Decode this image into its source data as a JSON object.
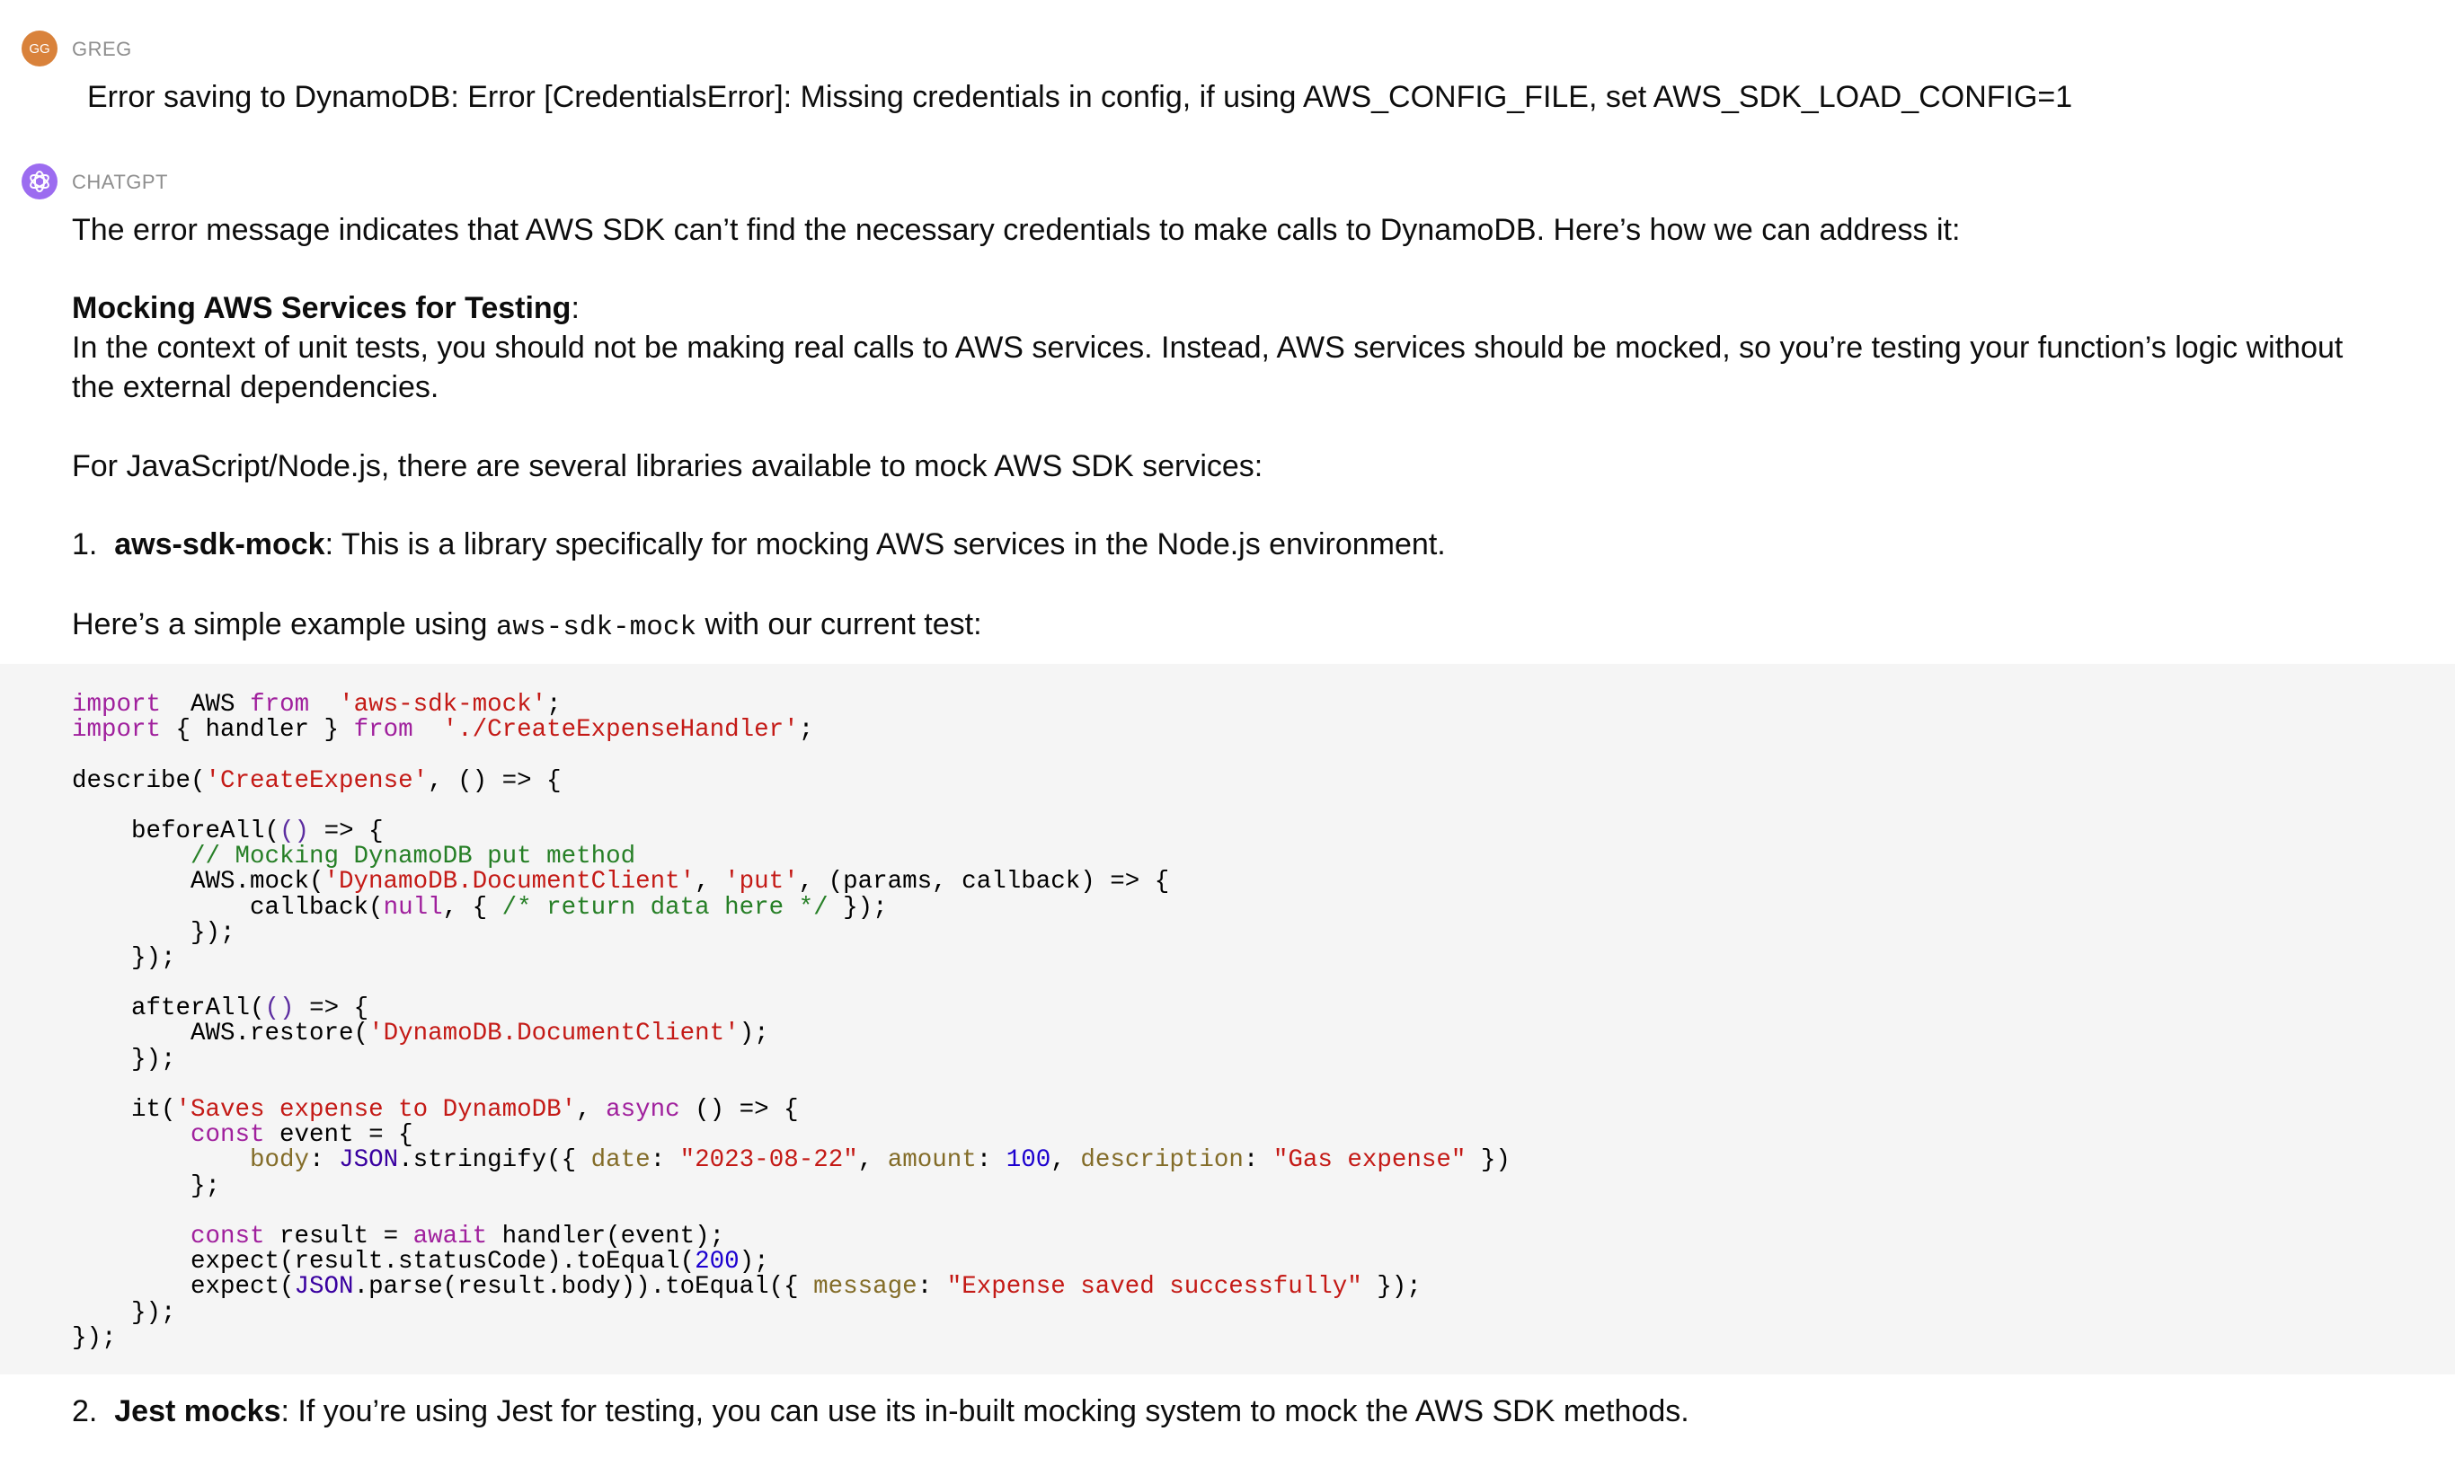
{
  "user": {
    "initials": "GG",
    "name": "GREG",
    "avatar_color": "#d9823b",
    "message": "Error saving to DynamoDB: Error [CredentialsError]: Missing credentials in config, if using AWS_CONFIG_FILE, set AWS_SDK_LOAD_CONFIG=1"
  },
  "assistant": {
    "name": "CHATGPT",
    "avatar_color": "#9c6cf0",
    "icon": "openai-logo-icon",
    "intro": "The error message indicates that AWS SDK can’t find the necessary credentials to make calls to DynamoDB. Here’s how we can address it:",
    "heading": "Mocking AWS Services for Testing",
    "heading_suffix": ":",
    "para1": "In the context of unit tests, you should not be making real calls to AWS services. Instead, AWS services should be mocked, so you’re testing your function’s logic without the external dependencies.",
    "para2": "For JavaScript/Node.js, there are several libraries available to mock AWS SDK services:",
    "item1": {
      "num": "1.",
      "title": "aws-sdk-mock",
      "text": ": This is a library specifically for mocking AWS services in the Node.js environment."
    },
    "example_pre": "Here’s a simple example using ",
    "example_code": "aws-sdk-mock",
    "example_post": " with our current test:",
    "item2": {
      "num": "2.",
      "title": "Jest mocks",
      "text": ": If you’re using Jest for testing, you can use its in-built mocking system to mock the AWS SDK methods."
    }
  },
  "code_lines": [
    [
      [
        "kw",
        "import"
      ],
      [
        "",
        "  AWS "
      ],
      [
        "kw",
        "from"
      ],
      [
        "",
        "  "
      ],
      [
        "str",
        "'aws-sdk-mock'"
      ],
      [
        "",
        ";"
      ]
    ],
    [
      [
        "kw",
        "import"
      ],
      [
        "",
        "",
        " { handler } "
      ],
      [
        "kw",
        "from"
      ],
      [
        "",
        "  "
      ],
      [
        "str",
        "'./CreateExpenseHandler'"
      ],
      [
        "",
        ";"
      ]
    ],
    [],
    [
      [
        "",
        "describe("
      ],
      [
        "str",
        "'CreateExpense'"
      ],
      [
        "",
        ", () => {"
      ]
    ],
    [],
    [
      [
        "",
        "    beforeAll("
      ],
      [
        "par",
        "()"
      ],
      [
        "",
        "",
        " => {"
      ]
    ],
    [
      [
        "com",
        "        // Mocking DynamoDB put method"
      ]
    ],
    [
      [
        "",
        "        AWS.mock("
      ],
      [
        "str",
        "'DynamoDB.DocumentClient'"
      ],
      [
        "",
        ", "
      ],
      [
        "str",
        "'put'"
      ],
      [
        "",
        ", (params, callback) => {"
      ]
    ],
    [
      [
        "",
        "            callback("
      ],
      [
        "kw",
        "null"
      ],
      [
        "",
        ", { "
      ],
      [
        "com",
        "/* return data here */"
      ],
      [
        "",
        "",
        " });"
      ]
    ],
    [
      [
        "",
        "        });"
      ]
    ],
    [
      [
        "",
        "    });"
      ]
    ],
    [],
    [
      [
        "",
        "    afterAll("
      ],
      [
        "par",
        "()"
      ],
      [
        "",
        "",
        " => {"
      ]
    ],
    [
      [
        "",
        "        AWS.restore("
      ],
      [
        "str",
        "'DynamoDB.DocumentClient'"
      ],
      [
        "",
        ");"
      ]
    ],
    [
      [
        "",
        "    });"
      ]
    ],
    [],
    [
      [
        "",
        "    it("
      ],
      [
        "str",
        "'Saves expense to DynamoDB'"
      ],
      [
        "",
        ", "
      ],
      [
        "kw",
        "async"
      ],
      [
        "",
        "",
        " () => {"
      ]
    ],
    [
      [
        "kw",
        "        const"
      ],
      [
        "",
        "",
        " event = {"
      ]
    ],
    [
      [
        "",
        "            "
      ],
      [
        "prop",
        "body"
      ],
      [
        "",
        ": "
      ],
      [
        "cls",
        "JSON"
      ],
      [
        "",
        ".stringify({ "
      ],
      [
        "prop",
        "date"
      ],
      [
        "",
        ": "
      ],
      [
        "str",
        "\"2023-08-22\""
      ],
      [
        "",
        ", "
      ],
      [
        "prop",
        "amount"
      ],
      [
        "",
        ": "
      ],
      [
        "num",
        "100"
      ],
      [
        "",
        ", "
      ],
      [
        "prop",
        "description"
      ],
      [
        "",
        ": "
      ],
      [
        "str",
        "\"Gas expense\""
      ],
      [
        "",
        "",
        " })"
      ]
    ],
    [
      [
        "",
        "        };"
      ]
    ],
    [],
    [
      [
        "kw",
        "        const"
      ],
      [
        "",
        "",
        " result = "
      ],
      [
        "kw",
        "await"
      ],
      [
        "",
        "",
        " handler(event);"
      ]
    ],
    [
      [
        "",
        "        expect(result.statusCode).toEqual("
      ],
      [
        "num",
        "200"
      ],
      [
        "",
        ");"
      ]
    ],
    [
      [
        "",
        "        expect("
      ],
      [
        "cls",
        "JSON"
      ],
      [
        "",
        ".parse(result.body)).toEqual({ "
      ],
      [
        "prop",
        "message"
      ],
      [
        "",
        ": "
      ],
      [
        "str",
        "\"Expense saved successfully\""
      ],
      [
        "",
        "",
        " });"
      ]
    ],
    [
      [
        "",
        "    });"
      ]
    ],
    [
      [
        "",
        "});"
      ]
    ]
  ]
}
